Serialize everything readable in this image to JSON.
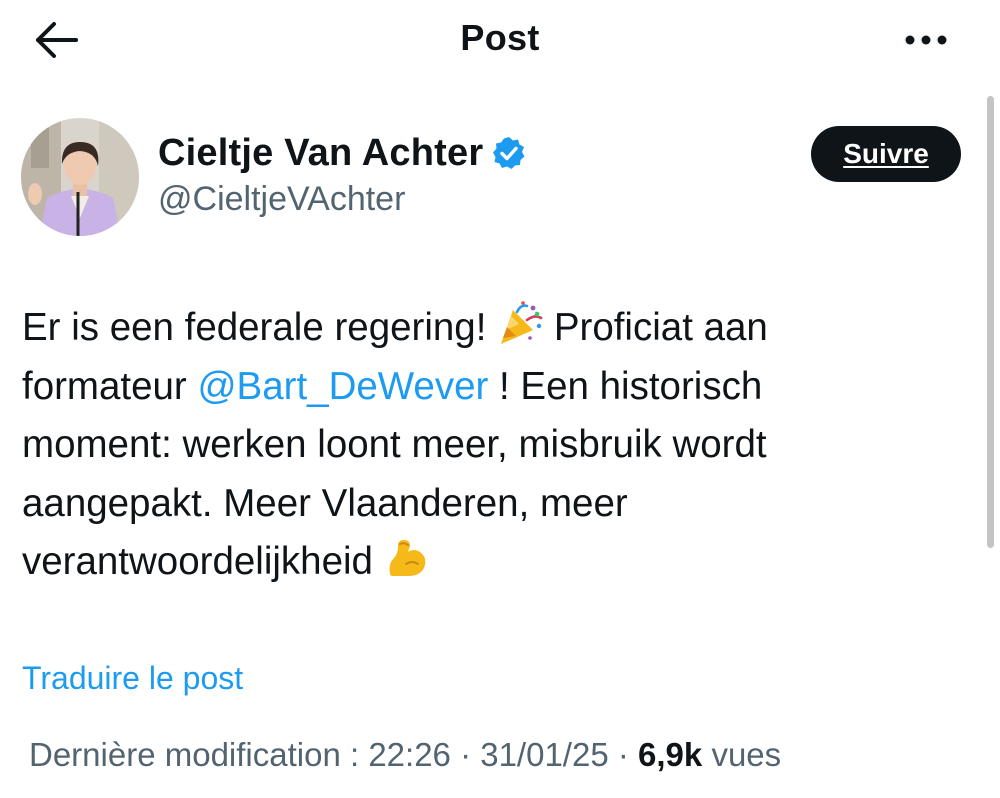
{
  "header": {
    "title": "Post",
    "back_icon": "arrow-left-icon",
    "more_icon": "more-horizontal-icon"
  },
  "author": {
    "display_name": "Cieltje Van Achter",
    "handle": "@CieltjeVAchter",
    "verified": true,
    "verified_color": "#1d9bf0",
    "avatar_icon": "avatar-photo"
  },
  "follow_button": {
    "label": "Suivre"
  },
  "tweet": {
    "line1_a": "Er is een federale regering!",
    "line1_emoji": "party-popper-icon",
    "line1_b": "Proficiat aan",
    "line2_a": "formateur",
    "line2_mention": "@Bart_DeWever",
    "line2_b": "! Een historisch",
    "line3": "moment: werken loont meer, misbruik wordt",
    "line4": "aangepakt. Meer Vlaanderen, meer",
    "line5_a": "verantwoordelijkheid",
    "line5_emoji": "flexed-biceps-icon"
  },
  "translate": {
    "label": "Traduire le post"
  },
  "meta": {
    "prefix": "Dernière modification : 22:26 · 31/01/25",
    "sep": "·",
    "views": "6,9k",
    "views_label": "vues"
  },
  "colors": {
    "text": "#0f1419",
    "secondary": "#536471",
    "link": "#1d9bf0",
    "button_bg": "#0f1419"
  }
}
